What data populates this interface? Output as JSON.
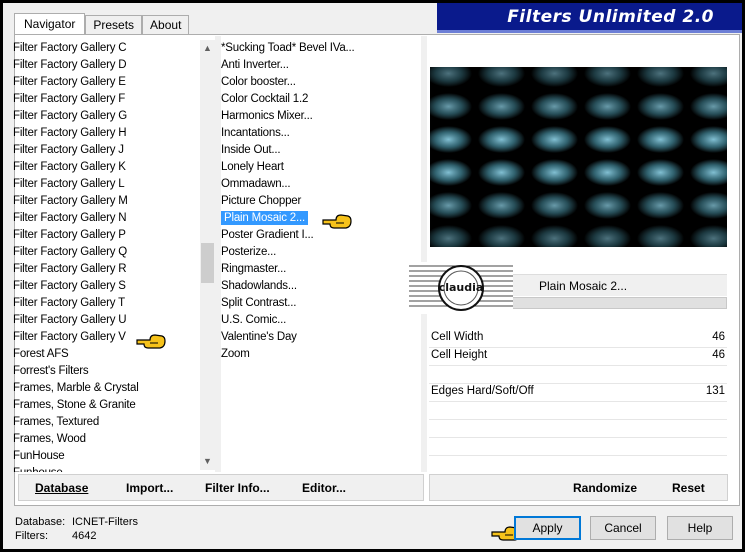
{
  "app": {
    "banner_title": "Filters Unlimited 2.0"
  },
  "tabs": [
    "Navigator",
    "Presets",
    "About"
  ],
  "categories": [
    "Filter Factory Gallery C",
    "Filter Factory Gallery D",
    "Filter Factory Gallery E",
    "Filter Factory Gallery F",
    "Filter Factory Gallery G",
    "Filter Factory Gallery H",
    "Filter Factory Gallery J",
    "Filter Factory Gallery K",
    "Filter Factory Gallery L",
    "Filter Factory Gallery M",
    "Filter Factory Gallery N",
    "Filter Factory Gallery P",
    "Filter Factory Gallery Q",
    "Filter Factory Gallery R",
    "Filter Factory Gallery S",
    "Filter Factory Gallery T",
    "Filter Factory Gallery U",
    "Filter Factory Gallery V",
    "Forest AFS",
    "Forrest's Filters",
    "Frames, Marble & Crystal",
    "Frames, Stone & Granite",
    "Frames, Textured",
    "Frames, Wood",
    "FunHouse",
    "Funhouse"
  ],
  "filters": [
    "*Sucking Toad*  Bevel IVa...",
    "Anti Inverter...",
    "Color booster...",
    "Color Cocktail 1.2",
    "Harmonics Mixer...",
    "Incantations...",
    "Inside Out...",
    "Lonely Heart",
    "Ommadawn...",
    "Picture Chopper",
    "Plain Mosaic 2...",
    "Poster Gradient I...",
    "Posterize...",
    "Ringmaster...",
    "Shadowlands...",
    "Split Contrast...",
    "U.S. Comic...",
    "Valentine's Day",
    "Zoom"
  ],
  "selected_filter_index": 10,
  "selected_filter_name": "Plain Mosaic 2...",
  "logo_text": "claudia",
  "params": [
    {
      "label": "Cell Width",
      "value": "46"
    },
    {
      "label": "Cell Height",
      "value": "46"
    },
    {
      "label": "Edges Hard/Soft/Off",
      "value": "131"
    }
  ],
  "left_buttons": {
    "database": "Database",
    "import": "Import...",
    "filter_info": "Filter Info...",
    "editor": "Editor..."
  },
  "right_buttons": {
    "randomize": "Randomize",
    "reset": "Reset"
  },
  "status": {
    "db_label": "Database:",
    "db_value": "ICNET-Filters",
    "filters_label": "Filters:",
    "filters_value": "4642"
  },
  "dialog_buttons": {
    "apply": "Apply",
    "cancel": "Cancel",
    "help": "Help"
  },
  "colors": {
    "selection": "#3399ff",
    "banner": "#0a1a8c",
    "cell_color": "#8fd3e8"
  }
}
